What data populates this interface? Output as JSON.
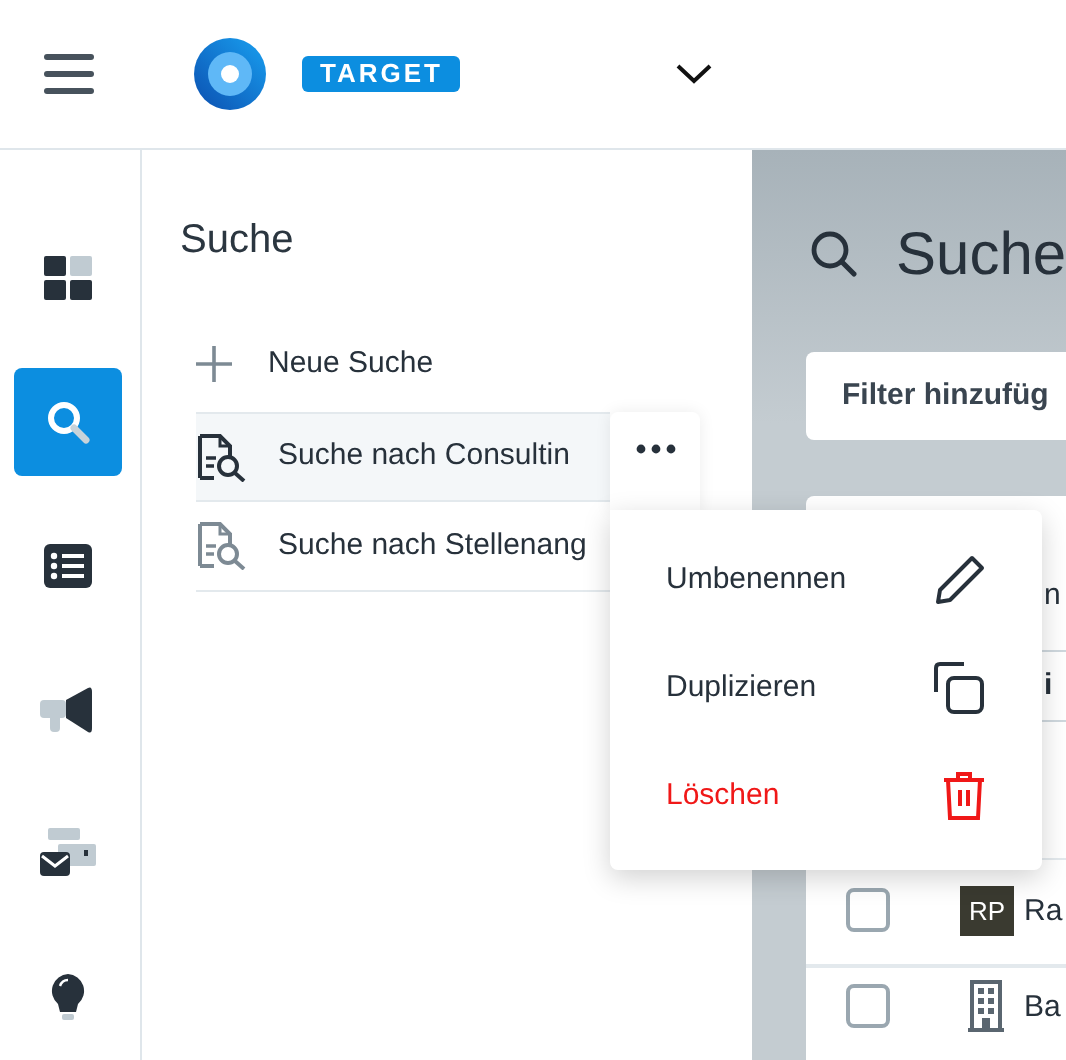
{
  "header": {
    "brand_badge": "TARGET"
  },
  "rail": [
    {
      "kind": "dashboard",
      "selected": false
    },
    {
      "kind": "search",
      "selected": true
    },
    {
      "kind": "list",
      "selected": false
    },
    {
      "kind": "megaphone",
      "selected": false
    },
    {
      "kind": "mail",
      "selected": false
    },
    {
      "kind": "bulb",
      "selected": false
    }
  ],
  "panel": {
    "title": "Suche",
    "new_search": "Neue Suche",
    "searches": [
      {
        "label": "Suche nach Consultin",
        "selected": true
      },
      {
        "label": "Suche nach Stellenang",
        "selected": false
      }
    ]
  },
  "context_menu": [
    {
      "label": "Umbenennen",
      "kind": "rename"
    },
    {
      "label": "Duplizieren",
      "kind": "duplicate"
    },
    {
      "label": "Löschen",
      "kind": "delete"
    }
  ],
  "main": {
    "title": "Suche",
    "filter_button": "Filter hinzufüg",
    "card_text_1": "n",
    "card_text_2": "i",
    "rows": [
      {
        "kind": "initials",
        "avatar": "RP",
        "name": "Ra",
        "checked": false
      },
      {
        "kind": "company",
        "name": "Ba",
        "checked": false
      }
    ]
  }
}
